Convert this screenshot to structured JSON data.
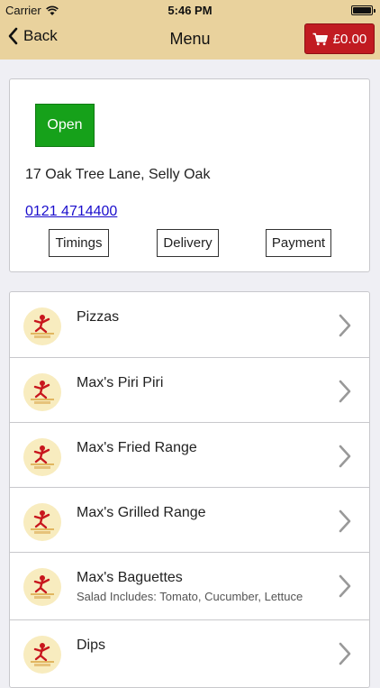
{
  "status_bar": {
    "carrier": "Carrier",
    "time": "5:46 PM",
    "battery_level": 1.0
  },
  "nav": {
    "back_label": "Back",
    "title": "Menu",
    "cart_total": "£0.00"
  },
  "info": {
    "status": "Open",
    "address": "17 Oak Tree Lane, Selly Oak",
    "phone": "0121 4714400",
    "buttons": {
      "timings": "Timings",
      "delivery": "Delivery",
      "payment": "Payment"
    }
  },
  "categories": [
    {
      "name": "Pizzas",
      "subtitle": ""
    },
    {
      "name": "Max's Piri Piri",
      "subtitle": ""
    },
    {
      "name": "Max's Fried Range",
      "subtitle": ""
    },
    {
      "name": "Max's Grilled Range",
      "subtitle": ""
    },
    {
      "name": "Max's Baguettes",
      "subtitle": "Salad Includes: Tomato, Cucumber, Lettuce"
    },
    {
      "name": "Dips",
      "subtitle": ""
    }
  ],
  "colors": {
    "header_bg": "#e9d29d",
    "cart_button": "#c11b21",
    "open_badge": "#16a11a",
    "link": "#1a0dcc"
  }
}
